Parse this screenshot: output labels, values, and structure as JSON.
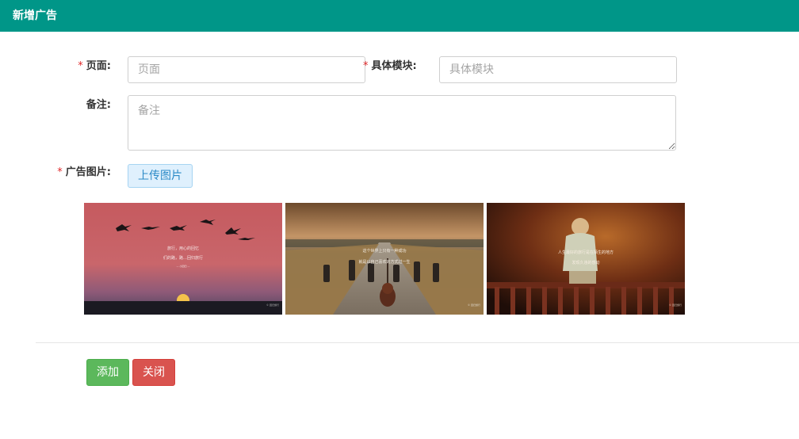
{
  "header": {
    "title": "新增广告"
  },
  "form": {
    "required_mark": "*",
    "page": {
      "label": "页面:",
      "placeholder": "页面",
      "value": ""
    },
    "module": {
      "label": "具体模块:",
      "placeholder": "具体模块",
      "value": ""
    },
    "remark": {
      "label": "备注:",
      "placeholder": "备注",
      "value": ""
    },
    "ad_image": {
      "label": "广告图片:",
      "upload_label": "上传图片"
    }
  },
  "images": [
    {
      "line1": "旅行，用心的回忆",
      "line2": "们的路，路…回归旅行",
      "line3": "— 小回归 —",
      "watermark": "© 回归旅行"
    },
    {
      "line1": "这个世界上只有一种成功",
      "line2": "就是以自己喜欢的方式过一生",
      "watermark": "© 回归旅行"
    },
    {
      "line1": "人生最好的旅行是在陌生的地方",
      "line2": "发现久违的感动",
      "watermark": "© 回归旅行"
    }
  ],
  "actions": {
    "add_label": "添加",
    "close_label": "关闭"
  },
  "colors": {
    "header": "#009688",
    "add": "#5cb85c",
    "close": "#d9534f",
    "required": "#e0282a"
  }
}
